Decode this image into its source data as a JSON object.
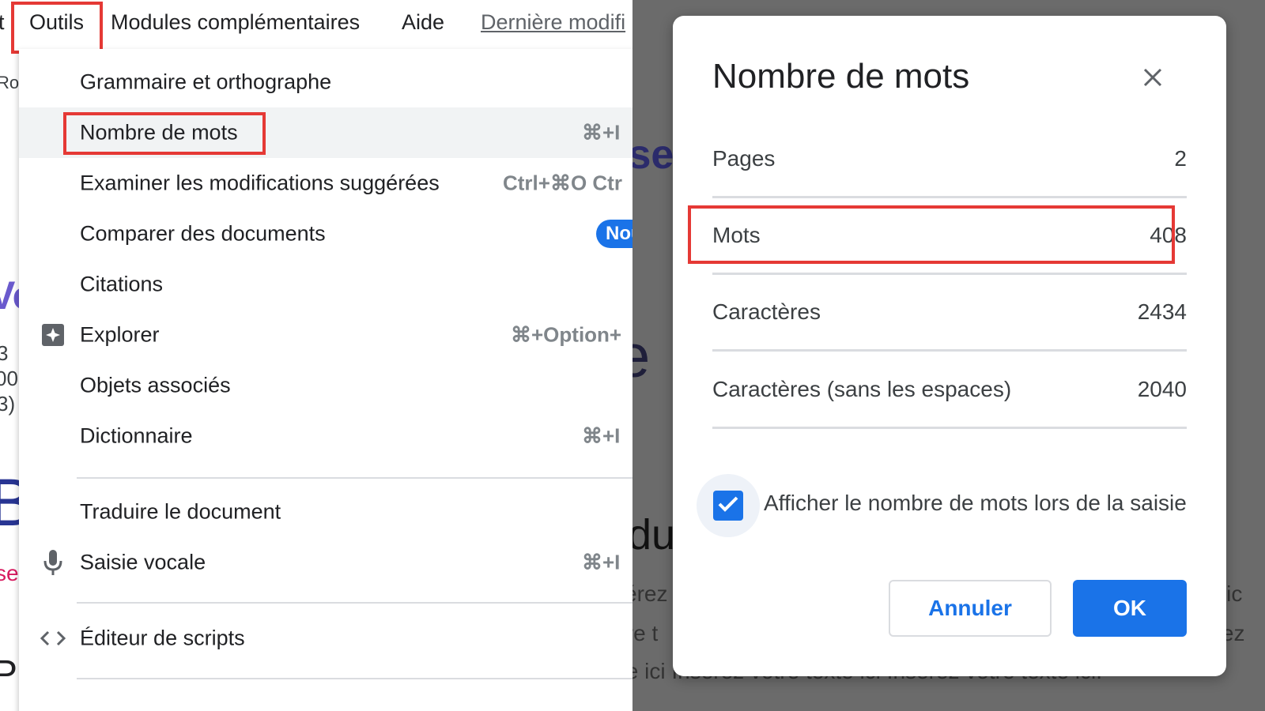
{
  "menubar": {
    "cut_item": "t",
    "outils": "Outils",
    "modules": "Modules complémentaires",
    "aide": "Aide",
    "last_edit": "Dernière modifi"
  },
  "left_edge": {
    "ro": "Ro",
    "vo": "Vo",
    "n1": "3",
    "n2": "00",
    "n3": "3)",
    "big_b": "B",
    "se": "se",
    "pr": "Pr"
  },
  "menu": {
    "items": [
      {
        "label": "Grammaire et orthographe",
        "shortcut": ""
      },
      {
        "label": "Nombre de mots",
        "shortcut": "⌘+I"
      },
      {
        "label": "Examiner les modifications suggérées",
        "shortcut": "Ctrl+⌘O Ctr"
      },
      {
        "label": "Comparer des documents",
        "badge": "Nou"
      },
      {
        "label": "Citations",
        "shortcut": ""
      },
      {
        "label": "Explorer",
        "shortcut": "⌘+Option+"
      },
      {
        "label": "Objets associés",
        "shortcut": ""
      },
      {
        "label": "Dictionnaire",
        "shortcut": "⌘+I"
      },
      {
        "label": "Traduire le document",
        "shortcut": ""
      },
      {
        "label": "Saisie vocale",
        "shortcut": "⌘+I"
      },
      {
        "label": "Éditeur de scripts",
        "shortcut": ""
      }
    ]
  },
  "background": {
    "ise": "ise",
    "e": "e",
    "du": "du",
    "erez": "sérez",
    "tre": "tre t",
    "teici": "te ic",
    "erez2": "érez",
    "bottom_line": "te ici Insérez votre texte ici Insérez votre texte ici."
  },
  "dialog": {
    "title": "Nombre de mots",
    "rows": [
      {
        "label": "Pages",
        "value": "2"
      },
      {
        "label": "Mots",
        "value": "408"
      },
      {
        "label": "Caractères",
        "value": "2434"
      },
      {
        "label": "Caractères (sans les espaces)",
        "value": "2040"
      }
    ],
    "checkbox_label": "Afficher le nombre de mots lors de la saisie",
    "checkbox_checked": true,
    "cancel_label": "Annuler",
    "ok_label": "OK"
  },
  "colors": {
    "accent": "#1a73e8",
    "highlight": "#e53935"
  }
}
